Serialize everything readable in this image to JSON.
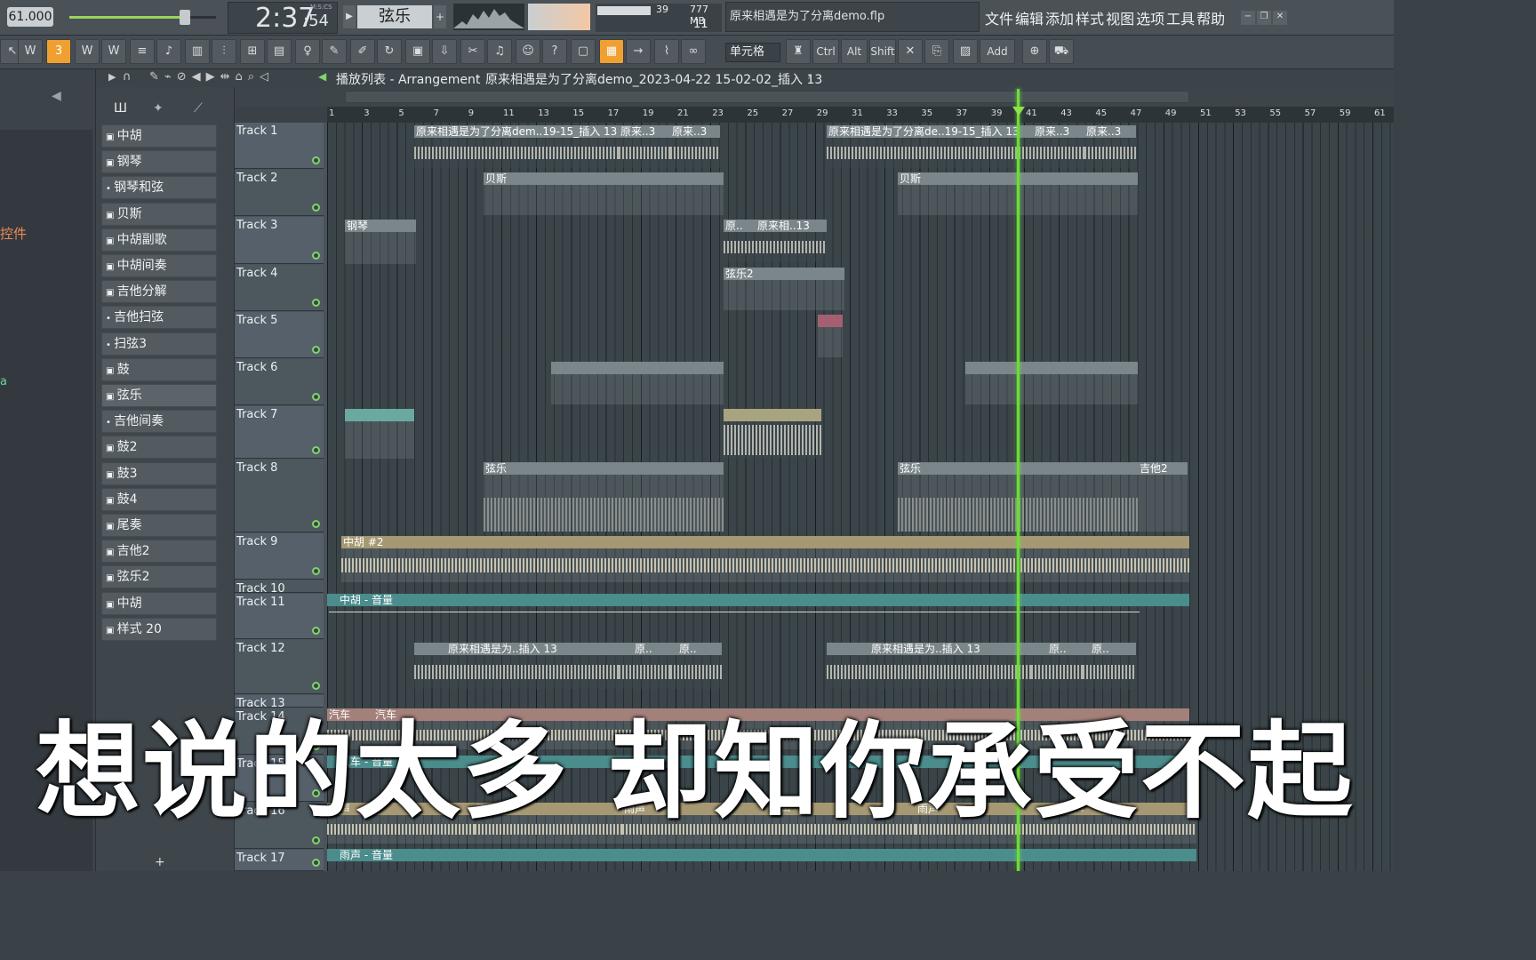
{
  "header": {
    "tempo": "61.000",
    "time_main": "2:37",
    "time_sub": ":54",
    "time_unit": "M:S:CS",
    "pattern_name": "弦乐",
    "cpu_value": "39",
    "memory": "777 MB",
    "polyphony": "11",
    "project_file": "原来相遇是为了分离demo.flp",
    "menu": [
      "文件",
      "编辑",
      "添加",
      "样式",
      "视图",
      "选项",
      "工具",
      "帮助"
    ]
  },
  "toolbar": {
    "snap_label": "单元格",
    "key_ctrl": "Ctrl",
    "key_alt": "Alt",
    "key_shift": "Shift",
    "add_label": "Add"
  },
  "breadcrumb": {
    "playlist": "播放列表 - Arrangement",
    "arrangement": "原来相遇是为了分离demo_2023-04-22 15-02-02_插入 13"
  },
  "left_panel": {
    "label_controls": "控件",
    "label_a": "a"
  },
  "patterns": [
    "中胡",
    "钢琴",
    "钢琴和弦",
    "贝斯",
    "中胡副歌",
    "中胡间奏",
    "吉他分解",
    "吉他扫弦",
    "扫弦3",
    "鼓",
    "弦乐",
    "吉他间奏",
    "鼓2",
    "鼓3",
    "鼓4",
    "尾奏",
    "吉他2",
    "弦乐2",
    "中胡",
    "样式 20"
  ],
  "tracks": [
    "Track 1",
    "Track 2",
    "Track 3",
    "Track 4",
    "Track 5",
    "Track 6",
    "Track 7",
    "Track 8",
    "Track 9",
    "Track 10",
    "Track 11",
    "Track 12",
    "Track 13",
    "Track 14",
    "Track 15",
    "Track 16",
    "Track 17"
  ],
  "ruler_ticks": [
    "1",
    "3",
    "5",
    "7",
    "9",
    "11",
    "13",
    "15",
    "17",
    "19",
    "21",
    "23",
    "25",
    "27",
    "29",
    "31",
    "33",
    "35",
    "37",
    "39",
    "41",
    "43",
    "45",
    "47",
    "49",
    "51",
    "53",
    "55",
    "57",
    "59",
    "61"
  ],
  "clips": {
    "t1a": "原来相遇是为了分离dem..19-15_插入 13",
    "t1b": "原来..3",
    "t1c": "原来..3",
    "t1d": "原来相遇是为了分离de..19-15_插入 13",
    "t1e": "原来..3",
    "t1f": "原来..3",
    "t2a": "贝斯",
    "t2b": "贝斯",
    "t3a": "钢琴",
    "t3b": "原..",
    "t3c": "原来相..13",
    "t4a": "弦乐2",
    "t8a": "弦乐",
    "t8b": "弦乐",
    "t8c": "吉他2",
    "t9a": "中胡 #2",
    "t11a": "中胡 - 音量",
    "t12a": "原来相遇是为..插入 13",
    "t12b": "原..",
    "t12c": "原..",
    "t12d": "原来相遇是为..插入 13",
    "t12e": "原..",
    "t12f": "原..",
    "t14a": "汽车",
    "t14b": "汽车",
    "t15a": "汽车 - 音量",
    "t16": "雨声",
    "t17a": "雨声 - 音量"
  },
  "subtitle": "想说的太多 却知你承受不起"
}
